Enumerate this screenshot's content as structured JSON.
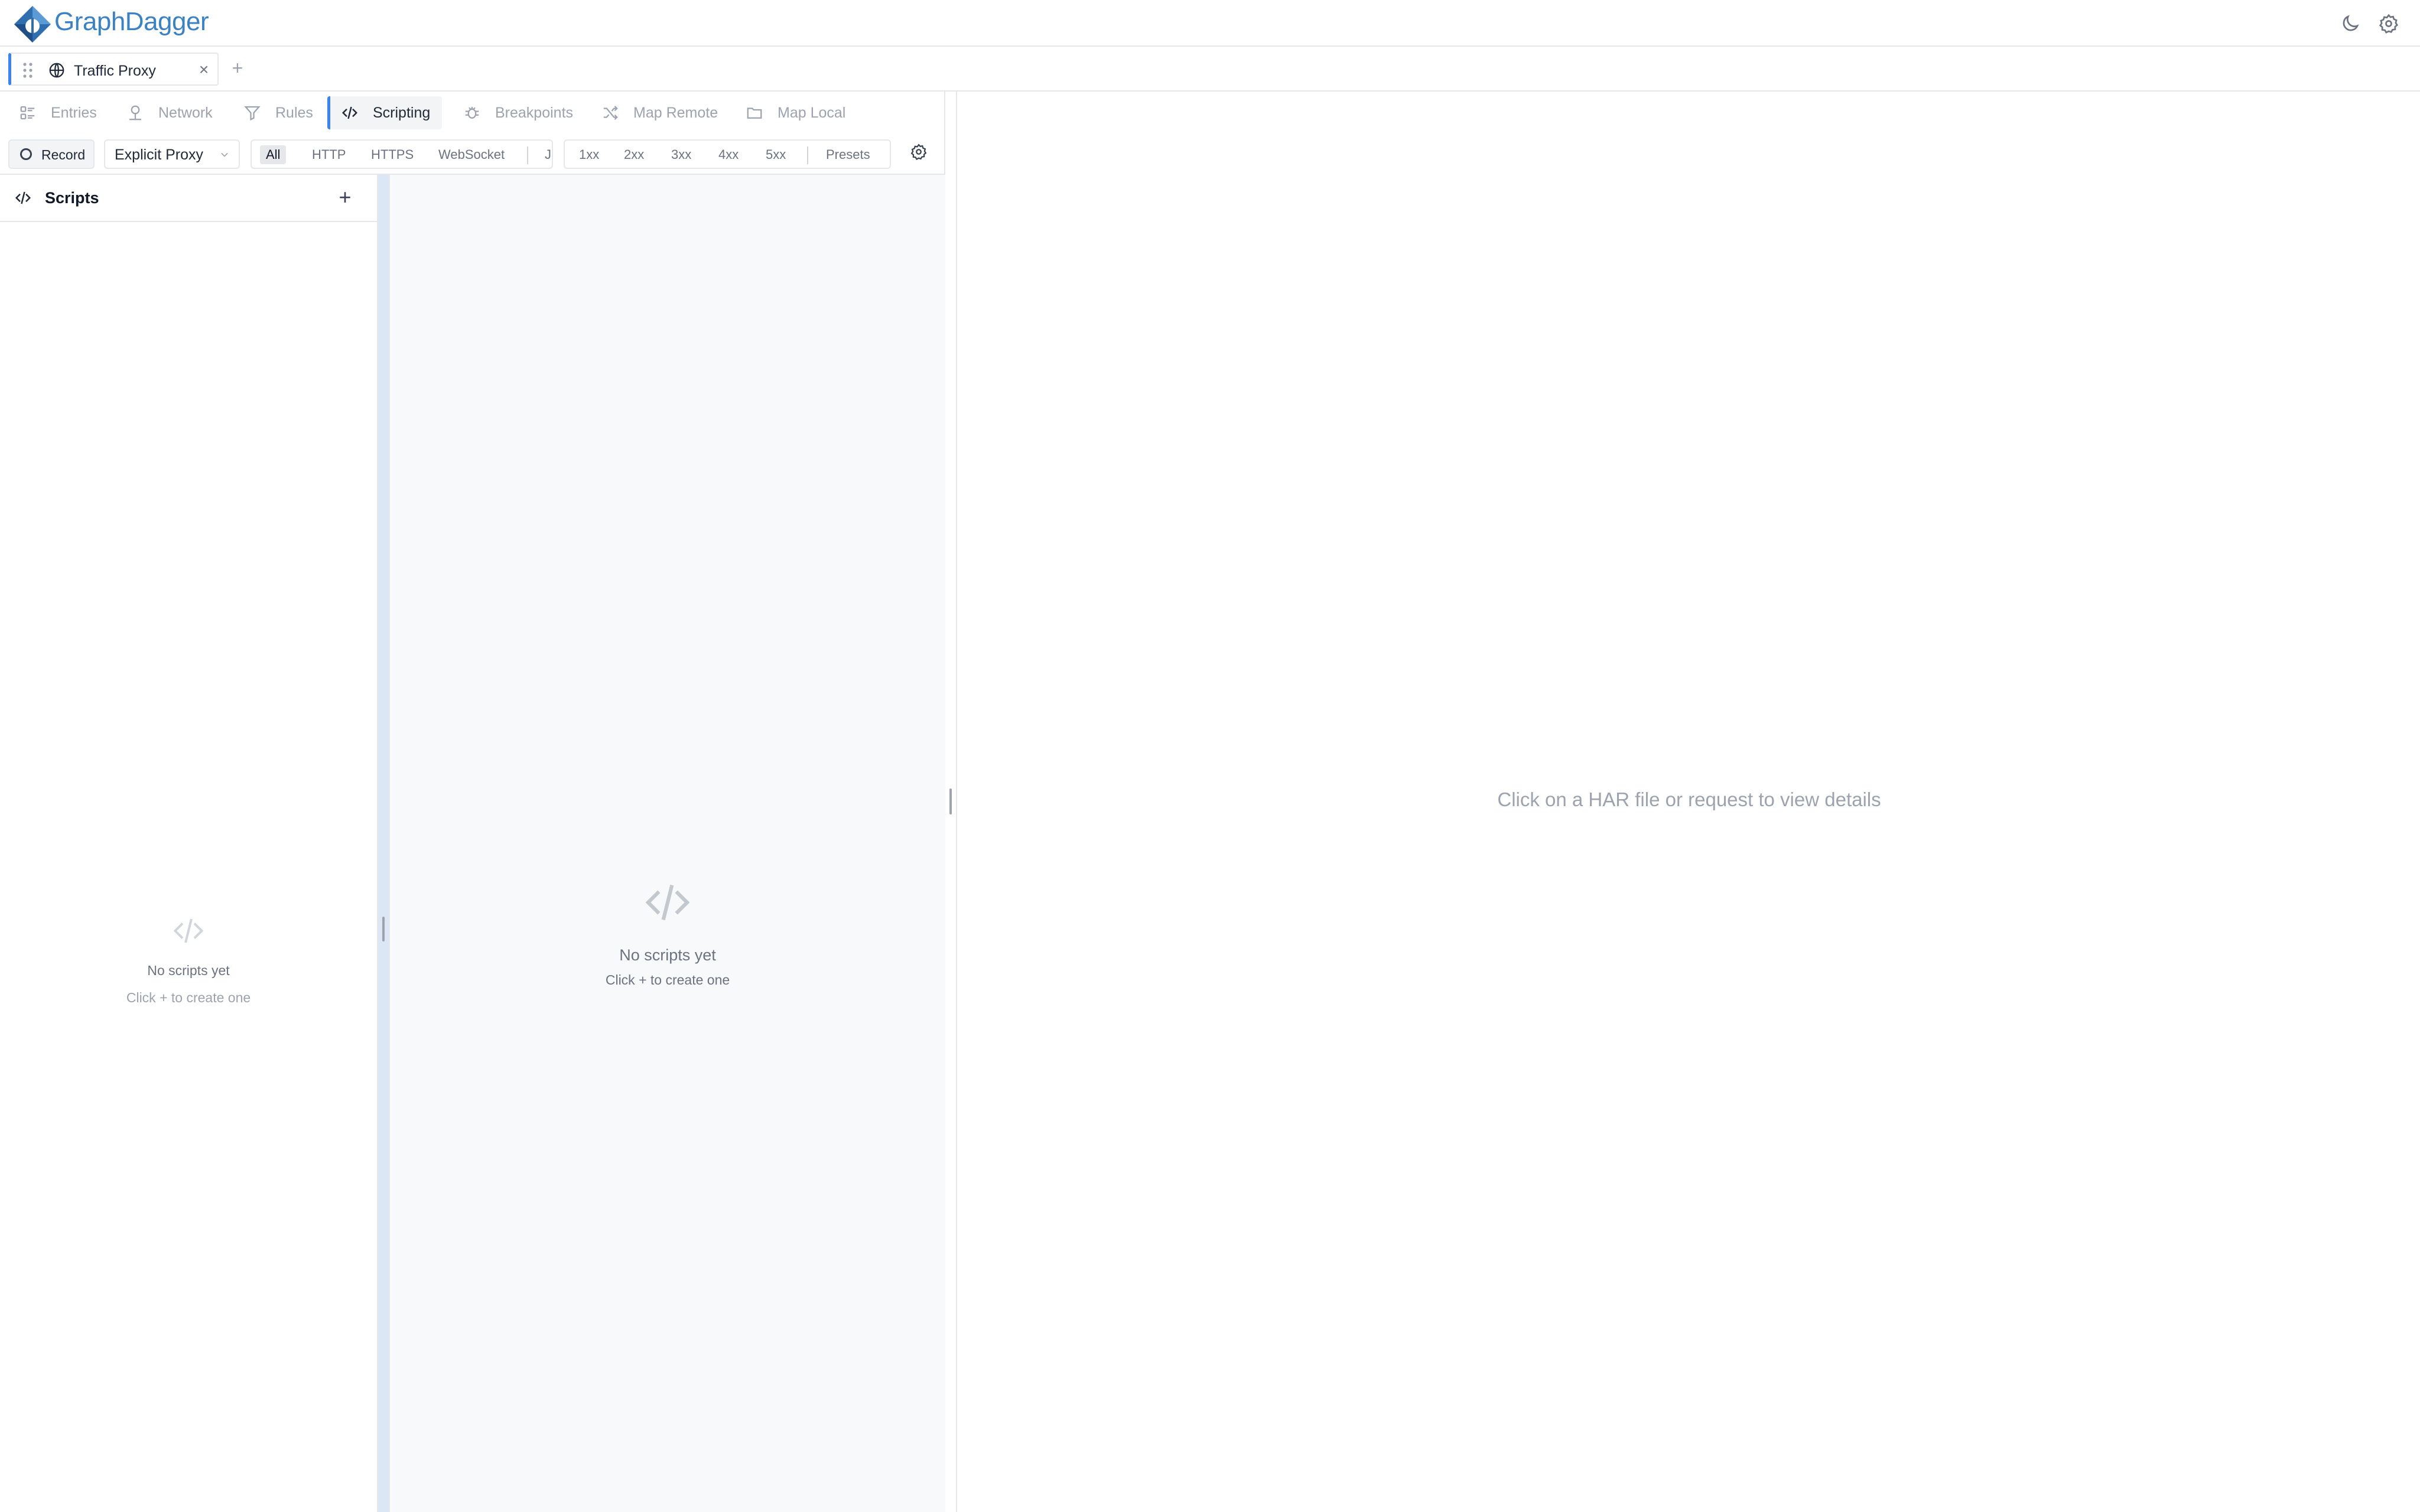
{
  "app": {
    "name": "GraphDagger",
    "brand_color": "#3b82c4",
    "accent_color": "#3b82f6"
  },
  "header": {
    "icons": [
      "theme-toggle-moon-icon",
      "settings-gear-icon"
    ]
  },
  "tabs": [
    {
      "label": "Traffic Proxy",
      "icon": "globe-icon",
      "active": true
    }
  ],
  "nav": {
    "items": [
      {
        "label": "Entries",
        "icon": "entries-list-icon"
      },
      {
        "label": "Network",
        "icon": "network-icon"
      },
      {
        "label": "Rules",
        "icon": "filter-icon"
      },
      {
        "label": "Scripting",
        "icon": "code-icon",
        "active": true
      },
      {
        "label": "Breakpoints",
        "icon": "bug-icon"
      },
      {
        "label": "Map Remote",
        "icon": "shuffle-icon"
      },
      {
        "label": "Map Local",
        "icon": "folder-icon"
      }
    ]
  },
  "toolbar": {
    "record_label": "Record",
    "proxy_mode": "Explicit Proxy",
    "protocols": [
      "All",
      "HTTP",
      "HTTPS",
      "WebSocket",
      "J"
    ],
    "selected_protocol": "All",
    "status_codes": [
      "1xx",
      "2xx",
      "3xx",
      "4xx",
      "5xx"
    ],
    "presets_label": "Presets"
  },
  "scripts_panel": {
    "title": "Scripts",
    "add_label": "+",
    "empty_title": "No scripts yet",
    "empty_hint": "Click + to create one"
  },
  "editor": {
    "empty_title": "No scripts yet",
    "empty_hint": "Click + to create one"
  },
  "details": {
    "placeholder": "Click on a HAR file or request to view details"
  }
}
